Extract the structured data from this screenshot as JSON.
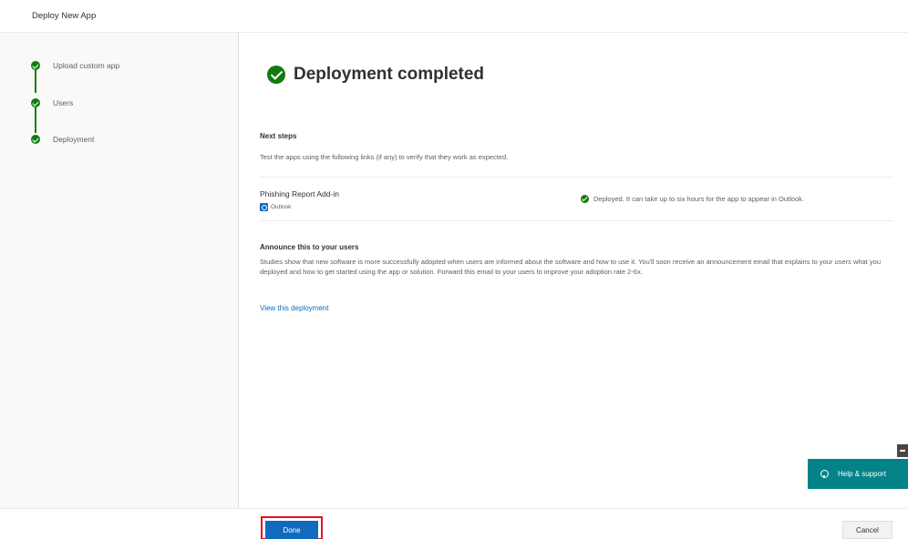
{
  "header": {
    "title": "Deploy New App"
  },
  "steps": [
    {
      "label": "Upload custom app",
      "status": "completed"
    },
    {
      "label": "Users",
      "status": "completed"
    },
    {
      "label": "Deployment",
      "status": "completed"
    }
  ],
  "main": {
    "heading": "Deployment completed",
    "next_steps": {
      "title": "Next steps",
      "description": "Test the apps using the following links (if any) to verify that they work as expected."
    },
    "app": {
      "name": "Phishing Report Add-in",
      "platform": "Outlook",
      "platform_icon": "outlook-icon",
      "status_text": "Deployed. It can take up to six hours for the app to appear in Outlook."
    },
    "announce": {
      "title": "Announce this to your users",
      "body": "Studies show that new software is more successfully adopted when users are informed about the software and how to use it. You'll soon receive an announcement email that explains to your users what you deployed and how to get started using the app or solution. Forward this email to your users to improve your adoption rate 2-6x."
    },
    "link_label": "View this deployment"
  },
  "help": {
    "label": "Help & support",
    "icon": "help-icon"
  },
  "footer": {
    "done_label": "Done",
    "cancel_label": "Cancel"
  },
  "colors": {
    "success": "#107c10",
    "primary": "#0f6cbd",
    "help_bg": "#038387",
    "highlight": "#e81123"
  }
}
